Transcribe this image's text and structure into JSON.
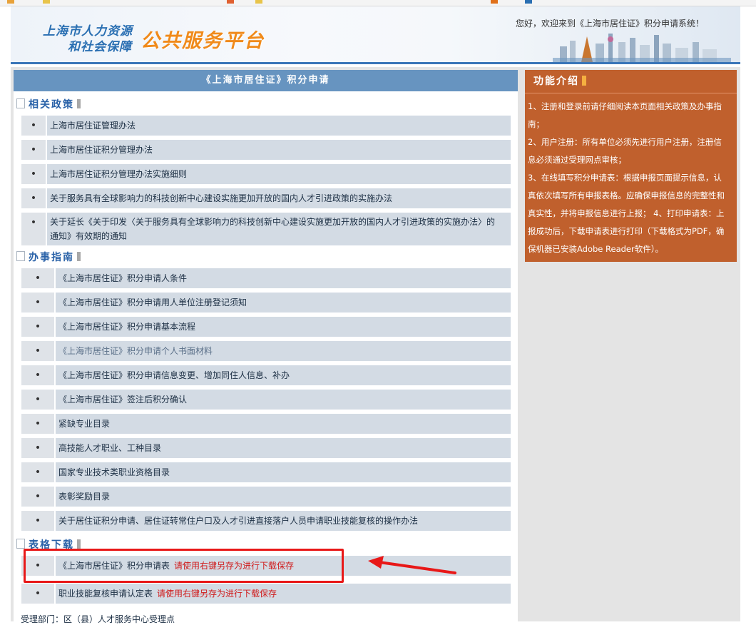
{
  "banner": {
    "org_line1": "上海市人力资源",
    "org_line2": "和社会保障",
    "platform": "公共服务平台",
    "welcome": "您好，欢迎来到《上海市居住证》积分申请系统！"
  },
  "main": {
    "title": "《上海市居住证》积分申请",
    "sections": {
      "policy": {
        "heading": "相关政策",
        "items": [
          "上海市居住证管理办法",
          "上海市居住证积分管理办法",
          "上海市居住证积分管理办法实施细则",
          "关于服务具有全球影响力的科技创新中心建设实施更加开放的国内人才引进政策的实施办法",
          "关于延长《关于印发〈关于服务具有全球影响力的科技创新中心建设实施更加开放的国内人才引进政策的实施办法〉的通知》有效期的通知"
        ]
      },
      "guide": {
        "heading": "办事指南",
        "items": [
          "《上海市居住证》积分申请人条件",
          "《上海市居住证》积分申请用人单位注册登记须知",
          "《上海市居住证》积分申请基本流程",
          "《上海市居住证》积分申请个人书面材料",
          "《上海市居住证》积分申请信息变更、增加同住人信息、补办",
          "《上海市居住证》签注后积分确认",
          "紧缺专业目录",
          "高技能人才职业、工种目录",
          "国家专业技术类职业资格目录",
          "表彰奖励目录",
          "关于居住证积分申请、居住证转常住户口及人才引进直接落户人员申请职业技能复核的操作办法"
        ]
      },
      "download": {
        "heading": "表格下载",
        "items": [
          {
            "label": "《上海市居住证》积分申请表",
            "hint": "请使用右键另存为进行下载保存"
          },
          {
            "label": "职业技能复核申请认定表",
            "hint": "请使用右键另存为进行下载保存"
          }
        ]
      }
    },
    "footer": "受理部门：区（县）人才服务中心受理点"
  },
  "sidebar": {
    "title": "功能介绍",
    "lines": [
      "1、注册和登录前请仔细阅读本页面相关政策及办事指",
      "南；",
      "2、用户注册：所有单位必须先进行用户注册，注册信",
      "息必须通过受理网点审核；",
      "3、在线填写积分申请表：根据申报页面提示信息，认",
      "真依次填写所有申报表格。应确保申报信息的完整性和",
      "真实性，并将申报信息进行上报；  4、打印申请表：上",
      "报成功后，下载申请表进行打印（下载格式为PDF，确",
      "保机器已安装Adobe Reader软件）。"
    ]
  },
  "bullet": "•",
  "colors": {
    "title_bar": "#6794c0",
    "row_bg": "#d3dbe4",
    "sidebar_bg": "#c0602d",
    "hint_red": "#d01a1a",
    "annotation_red": "#e81818"
  }
}
